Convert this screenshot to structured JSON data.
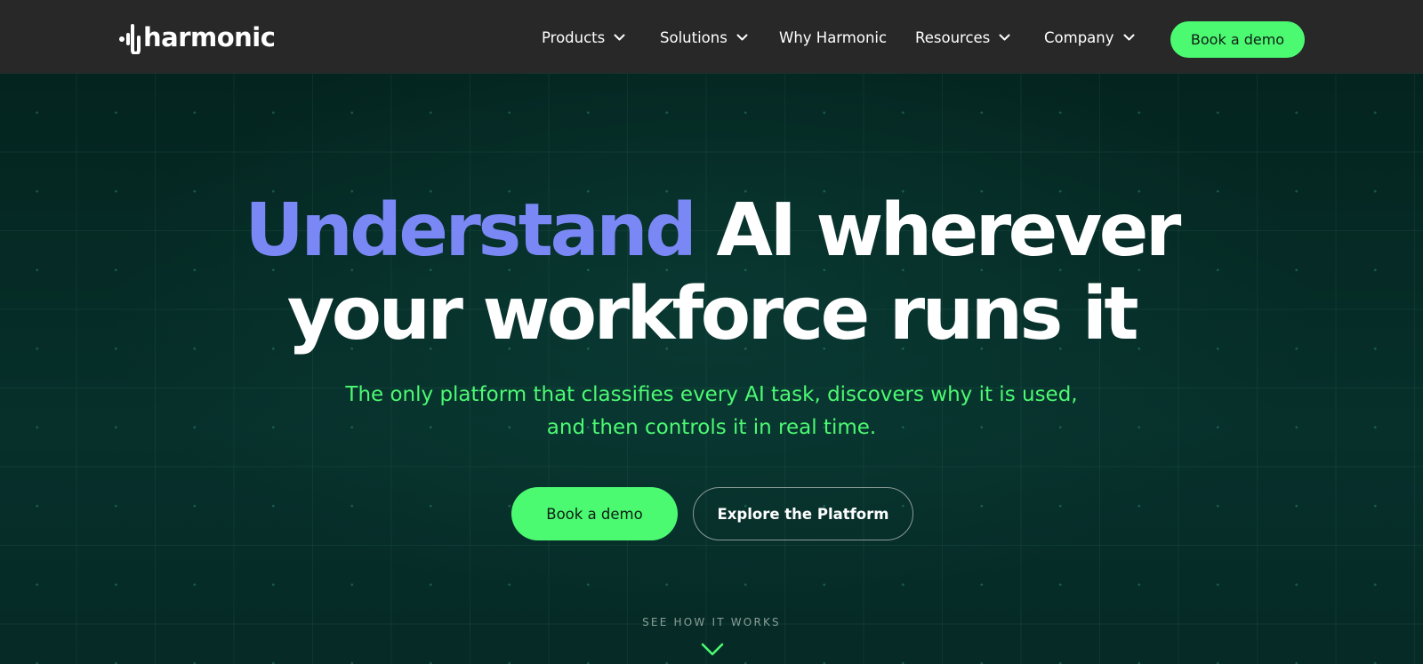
{
  "header": {
    "logo_text": "harmonic",
    "nav": [
      {
        "label": "Products",
        "has_dropdown": true
      },
      {
        "label": "Solutions",
        "has_dropdown": true
      },
      {
        "label": "Why Harmonic",
        "has_dropdown": false
      },
      {
        "label": "Resources",
        "has_dropdown": true
      },
      {
        "label": "Company",
        "has_dropdown": true
      }
    ],
    "cta_label": "Book a demo"
  },
  "hero": {
    "headline_accent": "Understand",
    "headline_rest_line1": "AI wherever",
    "headline_line2": "your workforce runs it",
    "subhead_line1": "The only platform that classifies every AI task, discovers why it is used,",
    "subhead_line2": "and then controls it in real time.",
    "primary_button": "Book a demo",
    "secondary_button": "Explore the Platform",
    "scroll_hint": "SEE HOW IT WORKS"
  },
  "icons": {
    "logo_mark": "waveform-icon",
    "dropdown": "chevron-down-icon",
    "scroll": "chevron-down-icon"
  },
  "colors": {
    "nav_background": "#282828",
    "hero_background": "#062824",
    "accent_green": "#4cfa72",
    "accent_purple": "#7a88f5",
    "text_white": "#ffffff"
  }
}
